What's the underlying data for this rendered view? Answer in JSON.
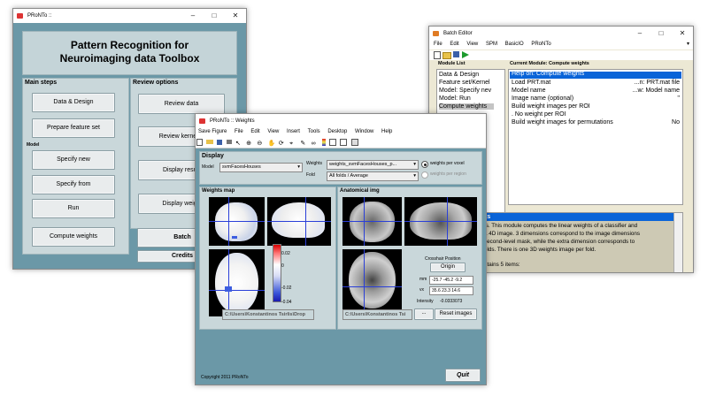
{
  "main_window": {
    "title": "PRoNTo ::",
    "header": "Pattern Recognition for Neuroimaging data Toolbox",
    "main_steps_title": "Main steps",
    "review_title": "Review options",
    "model_label": "Model",
    "buttons": {
      "data_design": "Data & Design",
      "prepare_feature": "Prepare feature set",
      "specify_new": "Specify new",
      "specify_from": "Specify from",
      "run": "Run",
      "compute_weights": "Compute weights",
      "review_data": "Review data",
      "review_kernel": "Review kernel &",
      "display_results": "Display result",
      "display_weights": "Display weigh",
      "batch": "Batch",
      "credits": "Credits"
    }
  },
  "batch_window": {
    "title": "Batch Editor",
    "menu": [
      "File",
      "Edit",
      "View",
      "SPM",
      "BasicIO",
      "PRoNTo"
    ],
    "module_list_title": "Module List",
    "modules": [
      "Data & Design",
      "Feature set/Kernel",
      "Model: Specify nev",
      "Model: Run",
      "Compute weights"
    ],
    "selected_module": "Compute weights",
    "current_module_title": "Current Module: Compute weights",
    "rows": [
      {
        "label": "Help on: Compute weights",
        "value": ""
      },
      {
        "label": "Load PRT.mat",
        "value": "...n: PRT.mat file"
      },
      {
        "label": "Model name",
        "value": "...w: Model name"
      },
      {
        "label": "Image name (optional)",
        "value": "''"
      },
      {
        "label": "Build weight images per ROI",
        "value": ""
      },
      {
        "label": ". No weight per ROI",
        "value": ""
      },
      {
        "label": "Build weight images for permutations",
        "value": "No"
      }
    ],
    "help_heading": "ts",
    "help_lines": [
      "ts.  This  module computes the linear weights of a classifier and",
      "  a 4D image. 3 dimensions correspond to the image dimensions",
      "  second-level mask,  while the extra dimension corresponds to",
      "olds. There is one 3D weights image per fold."
    ],
    "help_footer": "ntains 5 items:"
  },
  "weights_window": {
    "title": "PRoNTo :: Weights",
    "menu": [
      "Save Figure",
      "File",
      "Edit",
      "View",
      "Insert",
      "Tools",
      "Desktop",
      "Window",
      "Help"
    ],
    "display_title": "Display",
    "model_label": "Model",
    "model_value": "svmFacesHouses",
    "weights_label": "Weights",
    "weights_value": "weights_svmFacesHouses_p...",
    "fold_label": "Fold",
    "fold_value": "All folds / Average",
    "radio_voxel": "weights per voxel",
    "radio_region": "weights per region",
    "weights_map_title": "Weights map",
    "anatomical_title": "Anatomical img",
    "colorbar_ticks": [
      "0.02",
      "0",
      "-0.02",
      "-0.04"
    ],
    "crosshair_label": "Crosshair Position",
    "origin_label": "Origin",
    "mm_label": "mm",
    "mm_value": "-25.7 -45.2 -9.2",
    "vx_label": "vx",
    "vx_value": "35.6 23.3 14.6",
    "intensity_label": "Intensity",
    "intensity_value": "-0.0333073",
    "path_left": "C:\\Users\\Konstantinos Tsirlis\\Drop",
    "path_right": "C:\\Users\\Konstantinos Tsi",
    "browse_label": "...",
    "reset_label": "Reset images",
    "copyright": "Copyright 2011 PRoNTo",
    "quit_label": "Quit"
  },
  "colors": {
    "pronto_bg": "#6b98a7",
    "panel_bg": "#c9d7da",
    "header_bg": "#c4d4d8",
    "batch_bg": "#ece8d4",
    "selection": "#0a64d8"
  }
}
